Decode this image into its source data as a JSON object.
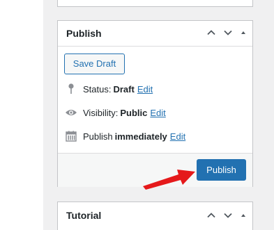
{
  "publish_box": {
    "title": "Publish",
    "save_draft_label": "Save Draft",
    "status": {
      "label": "Status:",
      "value": "Draft",
      "edit": "Edit"
    },
    "visibility": {
      "label": "Visibility:",
      "value": "Public",
      "edit": "Edit"
    },
    "publish_time": {
      "label": "Publish",
      "value": "immediately",
      "edit": "Edit"
    },
    "publish_button_label": "Publish"
  },
  "tutorial_box": {
    "title": "Tutorial"
  },
  "icons": {
    "move_up": "chevron-up-icon",
    "move_down": "chevron-down-icon",
    "toggle": "triangle-up-icon",
    "status": "pin-icon",
    "visibility": "eye-icon",
    "calendar": "calendar-icon"
  },
  "colors": {
    "accent": "#2271b1",
    "annotation_arrow": "#e5191b"
  }
}
